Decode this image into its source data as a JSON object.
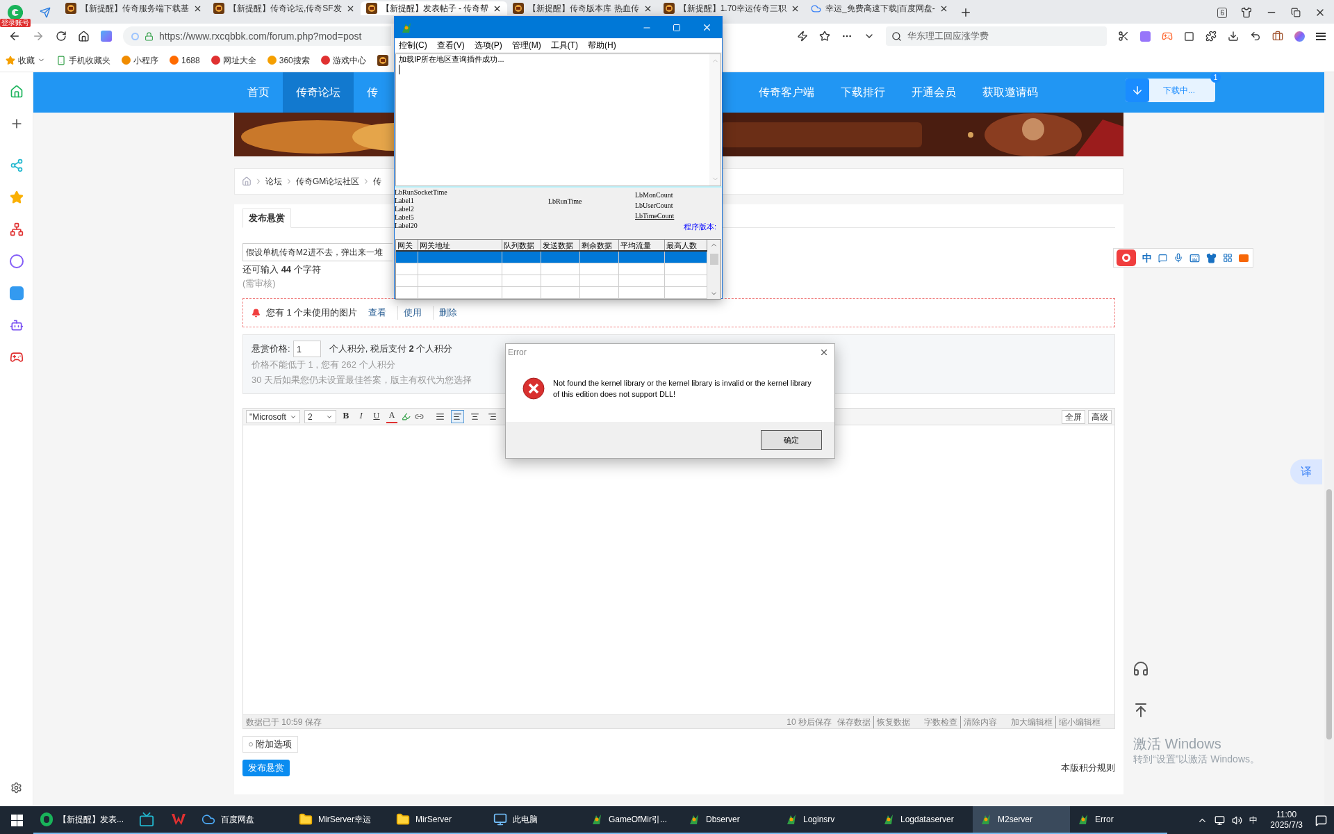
{
  "browser": {
    "account_badge": "登录账号",
    "tabs": [
      {
        "title": "【新提醒】传奇服务端下载基",
        "kind": "game",
        "selected": false
      },
      {
        "title": "【新提醒】传奇论坛,传奇SF发",
        "kind": "game",
        "selected": false
      },
      {
        "title": "【新提醒】发表帖子 - 传奇帮",
        "kind": "game",
        "selected": true
      },
      {
        "title": "【新提醒】传奇版本库 热血传",
        "kind": "game",
        "selected": false
      },
      {
        "title": "【新提醒】1.70幸运传奇三职",
        "kind": "game",
        "selected": false
      },
      {
        "title": "幸运_免费高速下载|百度网盘-",
        "kind": "cloud",
        "selected": false
      }
    ],
    "tab_count": "6",
    "address": "https://www.rxcqbbk.com/forum.php?mod=post",
    "search_placeholder": "华东理工回应涨学费",
    "bookmarks": [
      "收藏",
      "手机收藏夹",
      "小程序",
      "1688",
      "网址大全",
      "360搜索",
      "游戏中心"
    ],
    "download": {
      "label": "下载中...",
      "count": "1"
    }
  },
  "site": {
    "nav": [
      {
        "label": "首页",
        "selected": false
      },
      {
        "label": "传奇论坛",
        "selected": true
      },
      {
        "label": "传",
        "selected": false
      },
      {
        "label": "传奇客户端",
        "selected": false
      },
      {
        "label": "下载排行",
        "selected": false
      },
      {
        "label": "开通会员",
        "selected": false
      },
      {
        "label": "获取邀请码",
        "selected": false
      }
    ],
    "breadcrumb": [
      "论坛",
      "传奇GM论坛社区",
      "传"
    ],
    "form": {
      "tabs": [
        {
          "label": "发布悬赏",
          "selected": true
        }
      ],
      "title_value": "假设单机传奇M2进不去，弹出来一堆",
      "remaining": "还可输入 **44** 个字符",
      "review": "(需审核)",
      "notice": {
        "text": "您有 1 个未使用的图片",
        "actions": [
          "查看",
          "使用",
          "删除"
        ]
      },
      "reward": {
        "label": "悬赏价格:",
        "value": "1",
        "unit": "个人积分, 税后支付 **2** 个人积分",
        "hints": [
          "价格不能低于 1 , 您有 262 个人积分",
          "30 天后如果您仍未设置最佳答案，版主有权代为您选择"
        ]
      },
      "editor": {
        "font": "\"Microsoft",
        "size": "2",
        "format_buttons": [
          "B",
          "I",
          "U",
          "A"
        ],
        "align": [
          {
            "selected": false
          },
          {
            "selected": true
          },
          {
            "selected": false
          },
          {
            "selected": false
          }
        ],
        "right_buttons": [
          "全屏",
          "高级"
        ],
        "saved": "数据已于 10:59 保存",
        "autosave": "10 秒后保存",
        "links": [
          [
            "保存数据",
            "恢复数据"
          ],
          [
            "字数检查",
            "清除内容"
          ],
          [
            "加大编辑框",
            "缩小编辑框"
          ]
        ]
      },
      "extra": "附加选项",
      "submit": "发布悬赏",
      "rules": "本版积分规则"
    }
  },
  "m2_window": {
    "menu": [
      "控制(C)",
      "查看(V)",
      "选项(P)",
      "管理(M)",
      "工具(T)",
      "帮助(H)"
    ],
    "log": [
      "加载IP所在地区查询插件成功..."
    ],
    "labels_left": [
      "LbRunSocketTime",
      "Label1",
      "Label2",
      "Label5",
      "Label20"
    ],
    "label_center": "LbRunTime",
    "labels_right": [
      "LbMonCount",
      "LbUserCount",
      "LbTimeCount"
    ],
    "version": "程序版本:",
    "columns": [
      "网关",
      "网关地址",
      "队列数据",
      "发送数据",
      "剩余数据",
      "平均流量",
      "最高人数"
    ],
    "rows": [
      {
        "selected": true
      },
      {
        "selected": false
      },
      {
        "selected": false
      },
      {
        "selected": false
      }
    ]
  },
  "error_dialog": {
    "title": "Error",
    "message": "Not found the kernel library or the kernel library is invalid or the kernel library of this edition does not support DLL!",
    "button": "确定"
  },
  "ime_toolbar": {
    "mode": "中"
  },
  "translate": "译",
  "activation": {
    "title": "激活 Windows",
    "hint": "转到“设置”以激活 Windows。"
  },
  "taskbar": {
    "items": [
      {
        "kind": "browser",
        "label": "【新提醒】发表...",
        "selected": false
      },
      {
        "kind": "tv",
        "selected": false
      },
      {
        "kind": "wps",
        "selected": false
      },
      {
        "kind": "cloud",
        "label": "百度网盘",
        "selected": false
      },
      {
        "kind": "folder",
        "label": "MirServer幸运",
        "selected": false
      },
      {
        "kind": "folder",
        "label": "MirServer",
        "selected": false
      },
      {
        "kind": "computer",
        "label": "此电脑",
        "selected": false
      },
      {
        "kind": "mir",
        "label": "GameOfMir引...",
        "selected": false
      },
      {
        "kind": "mir",
        "label": "Dbserver",
        "selected": false
      },
      {
        "kind": "mir",
        "label": "Loginsrv",
        "selected": false
      },
      {
        "kind": "mir",
        "label": "Logdataserver",
        "selected": false
      },
      {
        "kind": "mir",
        "label": "M2server",
        "selected": true
      },
      {
        "kind": "mir",
        "label": "Error",
        "selected": false
      }
    ],
    "ime": "中",
    "time": "11:00",
    "date": "2025/7/3"
  }
}
